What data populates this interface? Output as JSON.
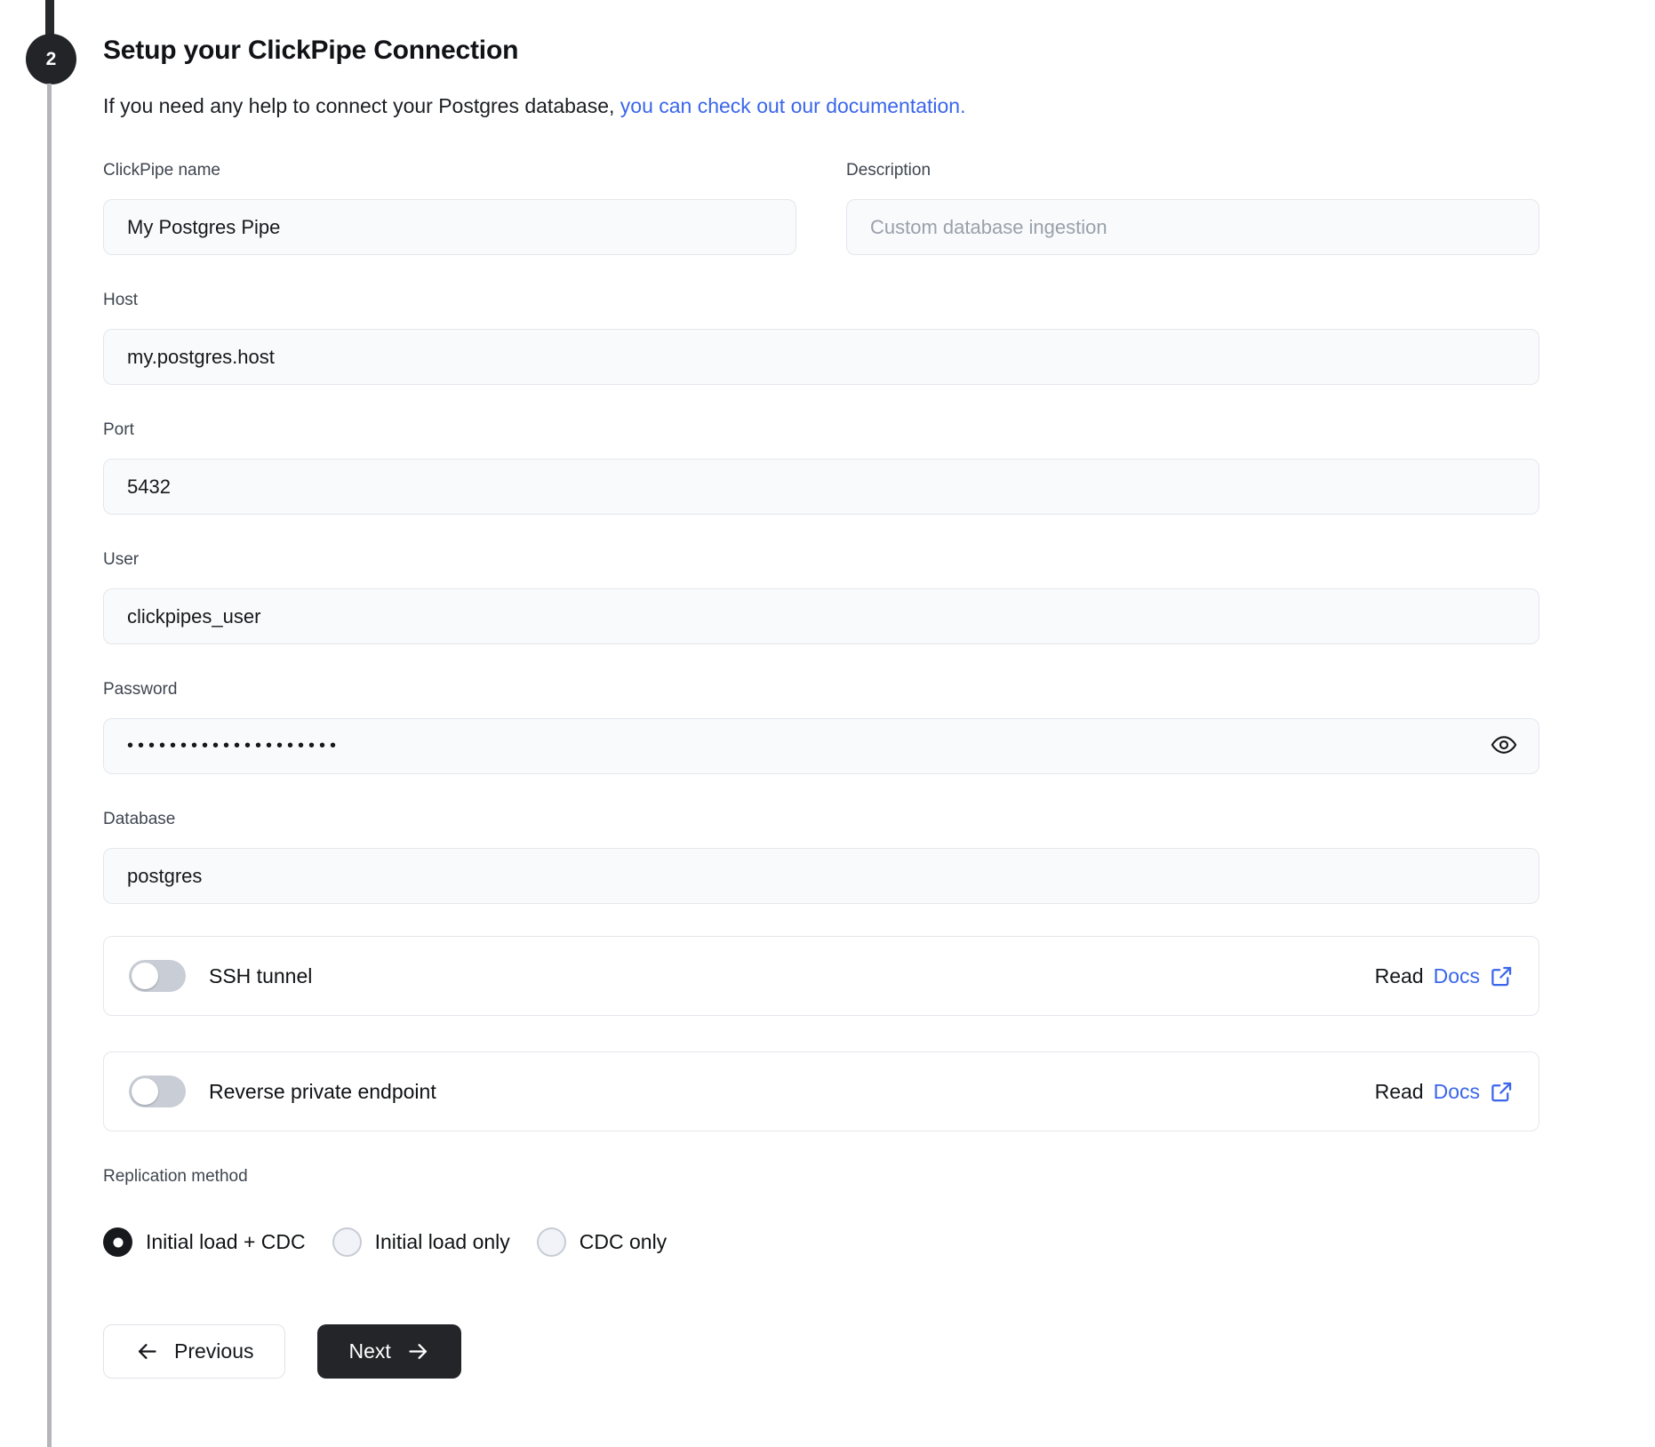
{
  "step": {
    "number": "2",
    "title": "Setup your ClickPipe Connection"
  },
  "intro": {
    "text": "If you need any help to connect your Postgres database, ",
    "link": "you can check out our documentation."
  },
  "fields": {
    "clickpipe_name": {
      "label": "ClickPipe name",
      "value": "My Postgres Pipe"
    },
    "description": {
      "label": "Description",
      "placeholder": "Custom database ingestion"
    },
    "host": {
      "label": "Host",
      "value": "my.postgres.host"
    },
    "port": {
      "label": "Port",
      "value": "5432"
    },
    "user": {
      "label": "User",
      "value": "clickpipes_user"
    },
    "password": {
      "label": "Password",
      "value": "••••••••••••••••••••"
    },
    "database": {
      "label": "Database",
      "value": "postgres"
    }
  },
  "toggles": [
    {
      "label": "SSH tunnel",
      "state": "off",
      "read_text": "Read",
      "docs_text": "Docs"
    },
    {
      "label": "Reverse private endpoint",
      "state": "off",
      "read_text": "Read",
      "docs_text": "Docs"
    }
  ],
  "replication": {
    "label": "Replication method",
    "options": [
      {
        "label": "Initial load + CDC",
        "selected": true
      },
      {
        "label": "Initial load only",
        "selected": false
      },
      {
        "label": "CDC only",
        "selected": false
      }
    ]
  },
  "actions": {
    "previous": "Previous",
    "next": "Next"
  },
  "colors": {
    "link_blue": "#3a66eb",
    "step_circle": "#222428",
    "next_button": "#232529",
    "input_background": "#f8fafc",
    "border": "#e4e7ec"
  }
}
